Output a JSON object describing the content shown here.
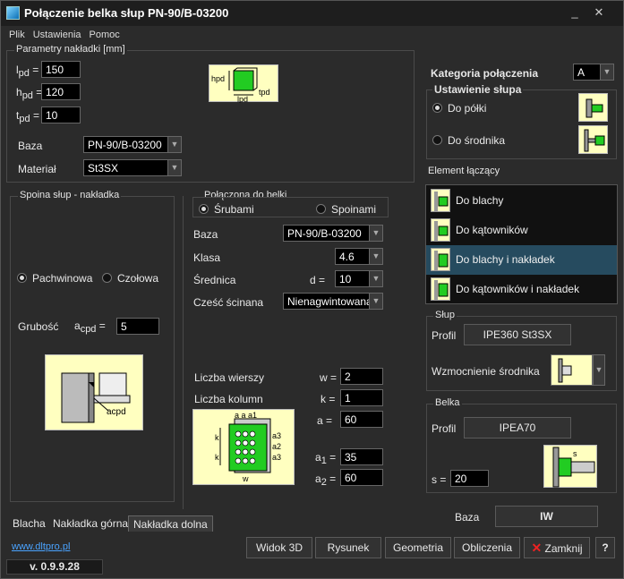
{
  "window": {
    "title": "Połączenie belka słup  PN-90/B-03200",
    "min_label": "_",
    "close_label": "✕"
  },
  "menu": [
    "Plik",
    "Ustawienia",
    "Pomoc"
  ],
  "params": {
    "title": "Parametry nakładki [mm]",
    "lpd": {
      "label_main": "l",
      "label_sub": "pd",
      "eq": "=",
      "value": "150"
    },
    "hpd": {
      "label_main": "h",
      "label_sub": "pd",
      "eq": "=",
      "value": "120"
    },
    "tpd": {
      "label_main": "t",
      "label_sub": "pd",
      "eq": "=",
      "value": "10"
    },
    "baza_label": "Baza",
    "baza_value": "PN-90/B-03200",
    "material_label": "Materiał",
    "material_value": "St3SX",
    "diagram": {
      "h": "hpd",
      "l": "lpd",
      "t": "tpd"
    }
  },
  "spoina": {
    "title": "Spoina słup - nakładka",
    "opt1": "Pachwinowa",
    "opt2": "Czołowa",
    "grubosc_label": "Grubość",
    "acpd_main": "a",
    "acpd_sub": "cpd",
    "eq": "=",
    "acpd_value": "5",
    "diagram_label": "acpd"
  },
  "polaczona": {
    "title": "Połączona do belki",
    "opt1": "Śrubami",
    "opt2": "Spoinami",
    "baza_label": "Baza",
    "baza_value": "PN-90/B-03200",
    "klasa_label": "Klasa",
    "klasa_value": "4.6",
    "srednica_label": "Średnica",
    "d_label": "d =",
    "d_value": "10",
    "czesc_label": "Cześć ścinana",
    "czesc_value": "Nienagwintowana",
    "wiersze_label": "Liczba wierszy",
    "w_label": "w =",
    "w_value": "2",
    "kolumn_label": "Liczba kolumn",
    "k_label": "k =",
    "k_value": "1",
    "a_label": "a =",
    "a_value": "60",
    "a1_main": "a",
    "a1_sub": "1",
    "a1_value": "35",
    "a2_main": "a",
    "a2_sub": "2",
    "a2_value": "60",
    "diagram": {
      "top": "a a a1",
      "k": "k",
      "w": "w",
      "a3": "a3",
      "a2": "a2"
    }
  },
  "tabs": [
    "Blacha",
    "Nakładka górna",
    "Nakładka dolna"
  ],
  "active_tab": "Nakładka dolna",
  "website": "www.dltpro.pl",
  "version": "v. 0.9.9.28",
  "kategoria": {
    "label": "Kategoria połączenia",
    "value": "A"
  },
  "ustawienie": {
    "title": "Ustawienie słupa",
    "opt1": "Do półki",
    "opt2": "Do środnika"
  },
  "element": {
    "title": "Element łączący",
    "items": [
      "Do blachy",
      "Do kątowników",
      "Do blachy i nakładek",
      "Do kątowników i nakładek"
    ],
    "selected": "Do blachy i nakładek"
  },
  "slup": {
    "title": "Słup",
    "profil_label": "Profil",
    "profil_value": "IPE360 St3SX",
    "wzmocnienie_label": "Wzmocnienie środnika"
  },
  "belka": {
    "title": "Belka",
    "profil_label": "Profil",
    "profil_value": "IPEA70",
    "s_label": "s =",
    "s_value": "20",
    "diagram_s": "s"
  },
  "baza_bottom": {
    "label": "Baza",
    "value": "IW"
  },
  "buttons": {
    "widok": "Widok 3D",
    "rysunek": "Rysunek",
    "geometria": "Geometria",
    "obliczenia": "Obliczenia",
    "zamknij": "Zamknij",
    "help": "?"
  },
  "colors": {
    "selection": "#264b5f",
    "link": "#4aa3ff",
    "diagram_bg": "#ffffc0",
    "plate_green": "#22cc22"
  }
}
